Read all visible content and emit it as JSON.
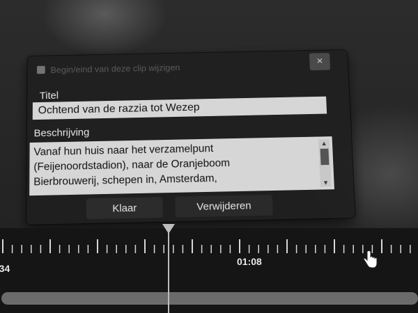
{
  "dialog": {
    "header_text": "Begin/eind van deze clip wijzigen",
    "close_label": "×",
    "title_label": "Titel",
    "title_value": "Ochtend van de razzia tot Wezep",
    "description_label": "Beschrijving",
    "description_lines": [
      "Vanaf hun huis naar het verzamelpunt",
      "(Feijenoordstadion), naar de Oranjeboom",
      "Bierbrouwerij, schepen in, Amsterdam,"
    ],
    "done_button": "Klaar",
    "delete_button": "Verwijderen"
  },
  "timeline": {
    "time_left": ":34",
    "time_mid": "01:08"
  },
  "icons": {
    "close": "close-icon",
    "scroll_up": "scroll-up-icon",
    "scroll_down": "scroll-down-icon",
    "cursor": "hand-cursor-icon"
  }
}
